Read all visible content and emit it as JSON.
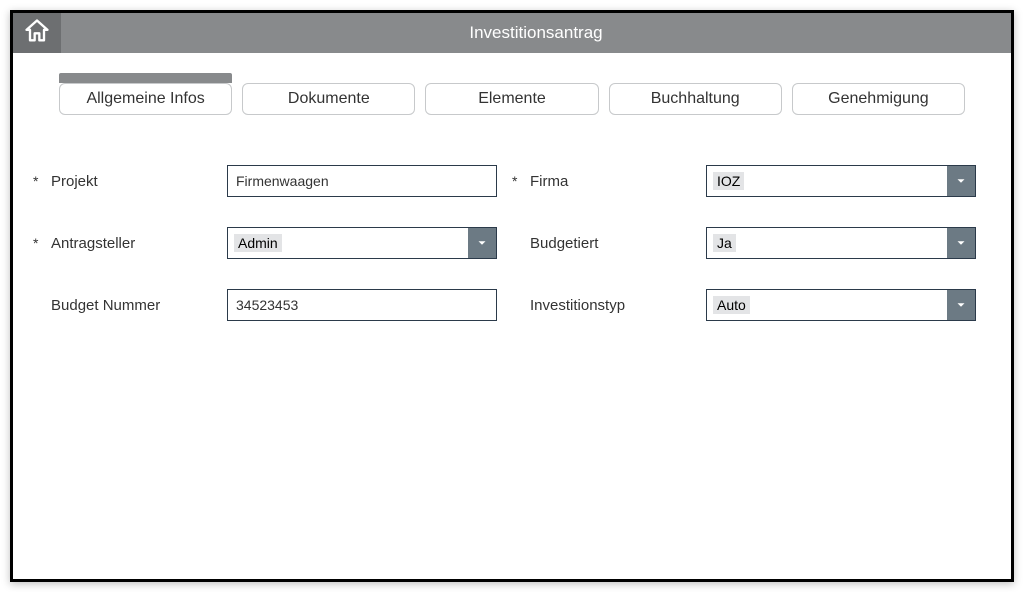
{
  "header": {
    "title": "Investitionsantrag"
  },
  "tabs": [
    {
      "label": "Allgemeine Infos",
      "active": true
    },
    {
      "label": "Dokumente",
      "active": false
    },
    {
      "label": "Elemente",
      "active": false
    },
    {
      "label": "Buchhaltung",
      "active": false
    },
    {
      "label": "Genehmigung",
      "active": false
    }
  ],
  "form": {
    "required_mark": "*",
    "projekt": {
      "label": "Projekt",
      "value": "Firmenwaagen",
      "required": true
    },
    "firma": {
      "label": "Firma",
      "value": "IOZ",
      "required": true
    },
    "antragsteller": {
      "label": "Antragsteller",
      "value": "Admin",
      "required": true
    },
    "budgetiert": {
      "label": "Budgetiert",
      "value": "Ja",
      "required": false
    },
    "budget_nummer": {
      "label": "Budget Nummer",
      "value": "34523453",
      "required": false
    },
    "investitionstyp": {
      "label": "Investitionstyp",
      "value": "Auto",
      "required": false
    }
  }
}
